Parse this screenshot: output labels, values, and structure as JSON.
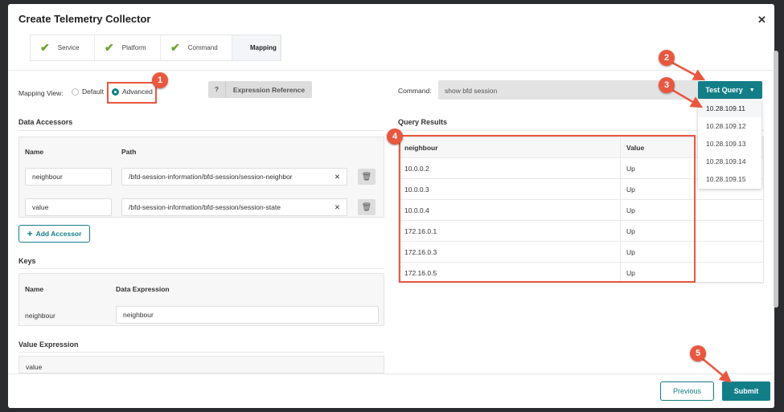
{
  "modal": {
    "title": "Create Telemetry Collector",
    "close_icon": "close-icon"
  },
  "steps": [
    {
      "label": "Service",
      "done": true
    },
    {
      "label": "Platform",
      "done": true
    },
    {
      "label": "Command",
      "done": true
    },
    {
      "label": "Mapping",
      "done": false,
      "active": true
    }
  ],
  "mapping_view": {
    "label": "Mapping View:",
    "options": [
      "Default",
      "Advanced"
    ],
    "selected": "Advanced"
  },
  "expression_reference": {
    "icon": "?",
    "label": "Expression Reference"
  },
  "data_accessors": {
    "title": "Data Accessors",
    "headers": [
      "Name",
      "Path"
    ],
    "rows": [
      {
        "name": "neighbour",
        "path": "/bfd-session-information/bfd-session/session-neighbor"
      },
      {
        "name": "value",
        "path": "/bfd-session-information/bfd-session/session-state"
      }
    ],
    "add_label": "Add Accessor"
  },
  "keys": {
    "title": "Keys",
    "headers": [
      "Name",
      "Data Expression"
    ],
    "rows": [
      {
        "name": "neighbour",
        "expression": "neighbour"
      }
    ]
  },
  "value_expression": {
    "title": "Value Expression",
    "value": "value"
  },
  "command": {
    "label": "Command:",
    "value": "show bfd session",
    "test_query_label": "Test Query",
    "devices": [
      "10.28.109.11",
      "10.28.109.12",
      "10.28.109.13",
      "10.28.109.14",
      "10.28.109.15"
    ]
  },
  "query_results": {
    "title": "Query Results",
    "headers": [
      "neighbour",
      "Value"
    ],
    "rows": [
      [
        "10.0.0.2",
        "Up"
      ],
      [
        "10.0.0.3",
        "Up"
      ],
      [
        "10.0.0.4",
        "Up"
      ],
      [
        "172.16.0.1",
        "Up"
      ],
      [
        "172.16.0.3",
        "Up"
      ],
      [
        "172.16.0.5",
        "Up"
      ]
    ]
  },
  "footer": {
    "previous": "Previous",
    "submit": "Submit"
  },
  "annotations": [
    "1",
    "2",
    "3",
    "4",
    "5"
  ],
  "colors": {
    "accent": "#127e88",
    "check": "#6aa42c",
    "annotation": "#e9573f"
  }
}
